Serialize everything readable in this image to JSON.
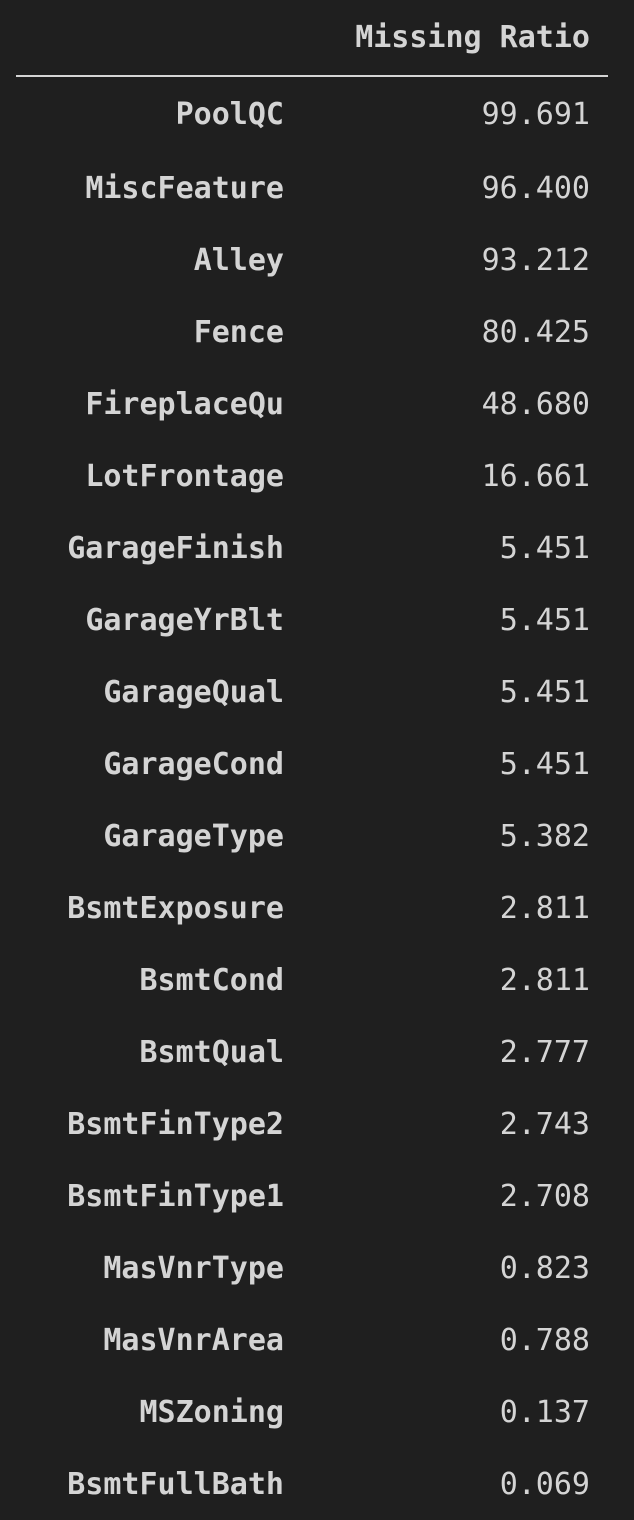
{
  "table": {
    "index_header": "",
    "column_header": "Missing Ratio",
    "rows": [
      {
        "feature": "PoolQC",
        "ratio": "99.691"
      },
      {
        "feature": "MiscFeature",
        "ratio": "96.400"
      },
      {
        "feature": "Alley",
        "ratio": "93.212"
      },
      {
        "feature": "Fence",
        "ratio": "80.425"
      },
      {
        "feature": "FireplaceQu",
        "ratio": "48.680"
      },
      {
        "feature": "LotFrontage",
        "ratio": "16.661"
      },
      {
        "feature": "GarageFinish",
        "ratio": "5.451"
      },
      {
        "feature": "GarageYrBlt",
        "ratio": "5.451"
      },
      {
        "feature": "GarageQual",
        "ratio": "5.451"
      },
      {
        "feature": "GarageCond",
        "ratio": "5.451"
      },
      {
        "feature": "GarageType",
        "ratio": "5.382"
      },
      {
        "feature": "BsmtExposure",
        "ratio": "2.811"
      },
      {
        "feature": "BsmtCond",
        "ratio": "2.811"
      },
      {
        "feature": "BsmtQual",
        "ratio": "2.777"
      },
      {
        "feature": "BsmtFinType2",
        "ratio": "2.743"
      },
      {
        "feature": "BsmtFinType1",
        "ratio": "2.708"
      },
      {
        "feature": "MasVnrType",
        "ratio": "0.823"
      },
      {
        "feature": "MasVnrArea",
        "ratio": "0.788"
      },
      {
        "feature": "MSZoning",
        "ratio": "0.137"
      },
      {
        "feature": "BsmtFullBath",
        "ratio": "0.069"
      }
    ]
  }
}
